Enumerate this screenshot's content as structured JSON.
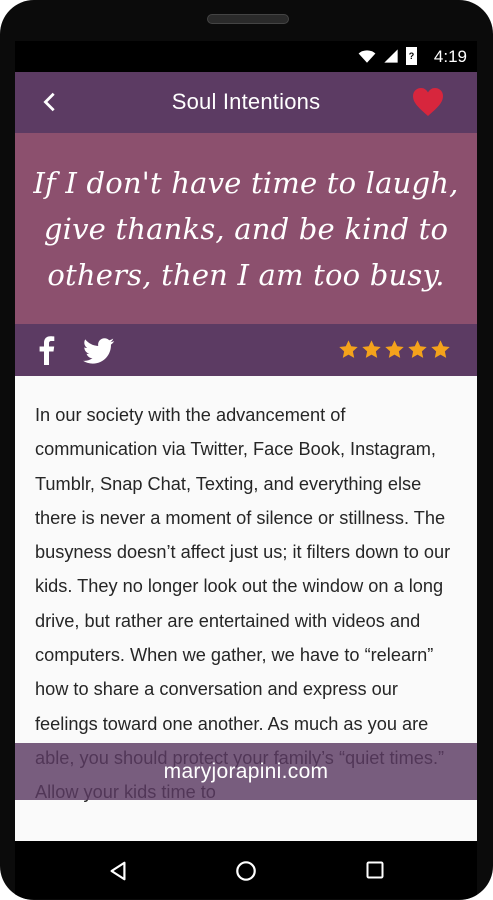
{
  "status": {
    "time": "4:19",
    "battery_text": "?"
  },
  "appbar": {
    "title": "Soul Intentions"
  },
  "quote": {
    "text": "If I don't have time to laugh, give thanks, and be kind to others, then I am too busy."
  },
  "share": {
    "rating": 5,
    "star_color": "#f4a21b"
  },
  "article": {
    "text": "In our society with the advancement of communication via Twitter, Face Book, Instagram, Tumblr, Snap Chat, Texting, and everything else there is never a moment of silence or stillness. The busyness doesn’t affect just us; it filters down to our kids. They no longer look out the window on a long drive, but rather are entertained with videos and computers. When we gather, we have to “relearn” how to share a conversation and express our feelings toward one another. As much as you are able, you should protect your family’s “quiet times.” Allow your kids time to"
  },
  "footer": {
    "site": "maryjorapini.com"
  },
  "colors": {
    "header": "#5c3b63",
    "quote_bg": "#8c506e",
    "heart": "#d7263d"
  },
  "icons": {
    "back": "back-arrow-icon",
    "favorite": "heart-icon",
    "facebook": "facebook-icon",
    "twitter": "twitter-icon",
    "star": "star-icon",
    "nav_back": "nav-back-icon",
    "nav_home": "nav-home-icon",
    "nav_recent": "nav-recent-icon"
  }
}
